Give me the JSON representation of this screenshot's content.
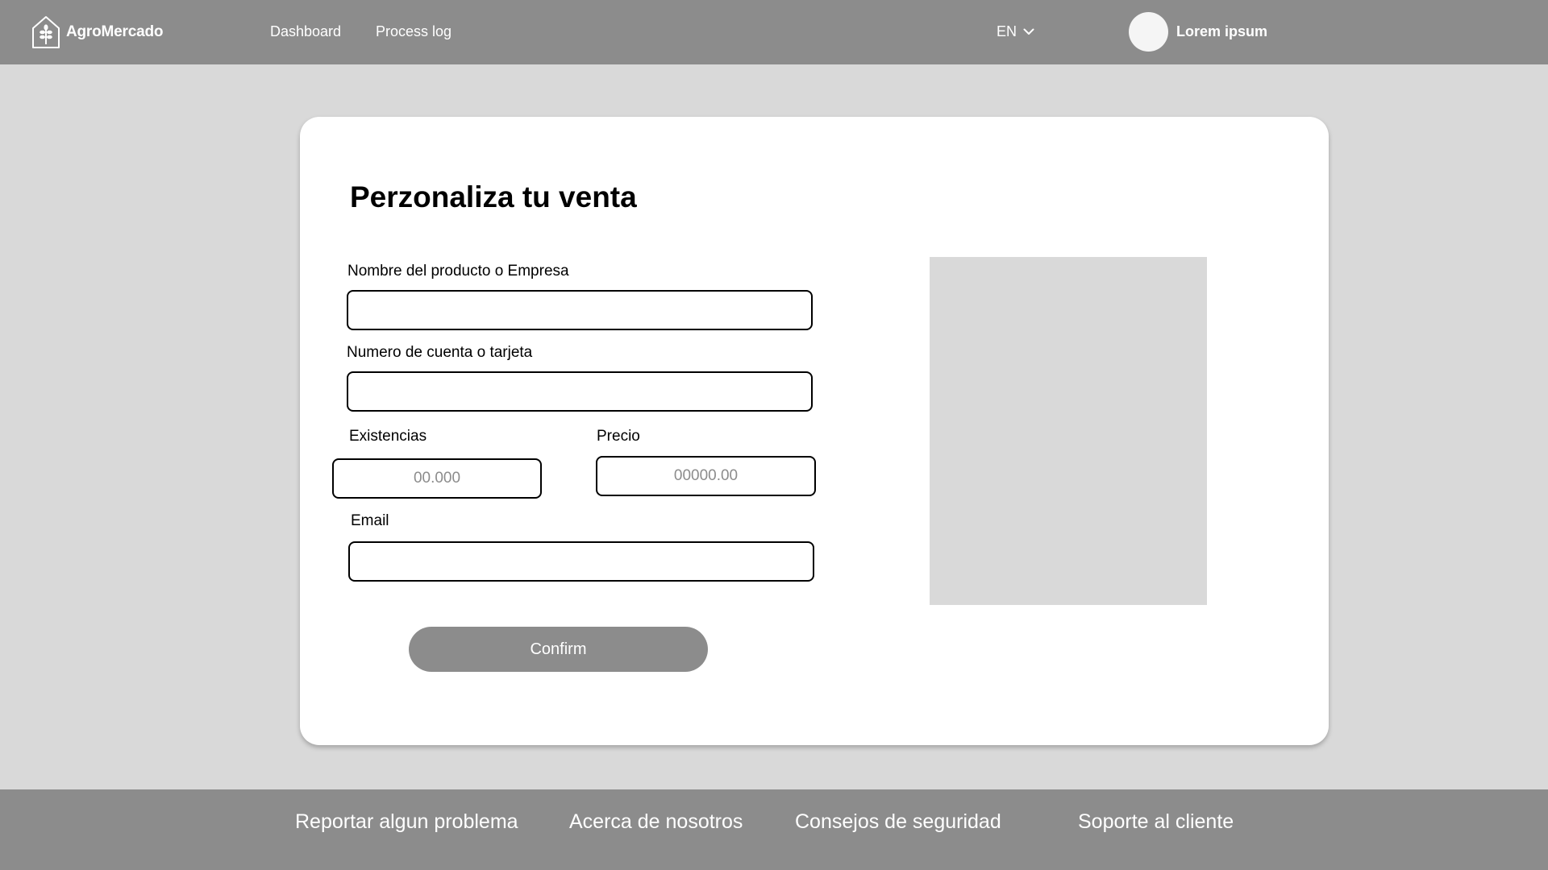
{
  "header": {
    "brand": "AgroMercado",
    "logo_icon": "wheat-house-icon",
    "nav": {
      "dashboard": "Dashboard",
      "process_log": "Process log"
    },
    "language": "EN",
    "language_icon": "chevron-down-icon",
    "user_name": "Lorem ipsum"
  },
  "form": {
    "title": "Perzonaliza tu venta",
    "product_label": "Nombre del producto o Empresa",
    "product_value": "",
    "account_label": "Numero de cuenta o tarjeta",
    "account_value": "",
    "stock_label": "Existencias",
    "stock_placeholder": "00.000",
    "price_label": "Precio",
    "price_placeholder": "00000.00",
    "email_label": "Email",
    "email_value": "",
    "confirm_label": "Confirm"
  },
  "footer": {
    "links": [
      "Reportar algun problema",
      "Acerca de nosotros",
      "Consejos de seguridad",
      "Soporte al cliente"
    ]
  },
  "colors": {
    "bars": "#8c8c8c",
    "page_background": "#d9d9d9",
    "card_background": "#ffffff",
    "image_placeholder": "#d9d9d9"
  }
}
